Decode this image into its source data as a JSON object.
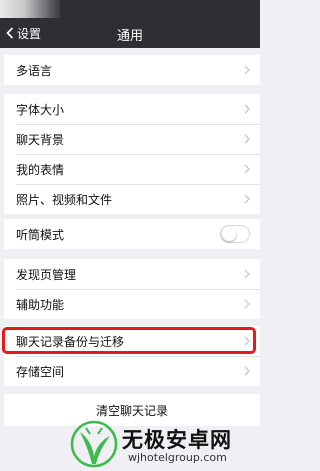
{
  "nav": {
    "back_label": "设置",
    "title": "通用"
  },
  "groups": [
    {
      "items": [
        {
          "label": "多语言"
        }
      ]
    },
    {
      "items": [
        {
          "label": "字体大小"
        },
        {
          "label": "聊天背景"
        },
        {
          "label": "我的表情"
        },
        {
          "label": "照片、视频和文件"
        }
      ]
    },
    {
      "items": [
        {
          "label": "听筒模式",
          "toggle": false
        }
      ]
    },
    {
      "items": [
        {
          "label": "发现页管理"
        },
        {
          "label": "辅助功能"
        }
      ]
    },
    {
      "items": [
        {
          "label": "聊天记录备份与迁移",
          "highlighted": true
        },
        {
          "label": "存储空间"
        }
      ]
    }
  ],
  "clear_chat_label": "清空聊天记录",
  "watermark": {
    "title": "无极安卓网",
    "url": "wjhotelgroup.com"
  },
  "colors": {
    "navbar": "#2e2e33",
    "highlight": "#e8191e",
    "logo_green": "#3dbb4e"
  }
}
